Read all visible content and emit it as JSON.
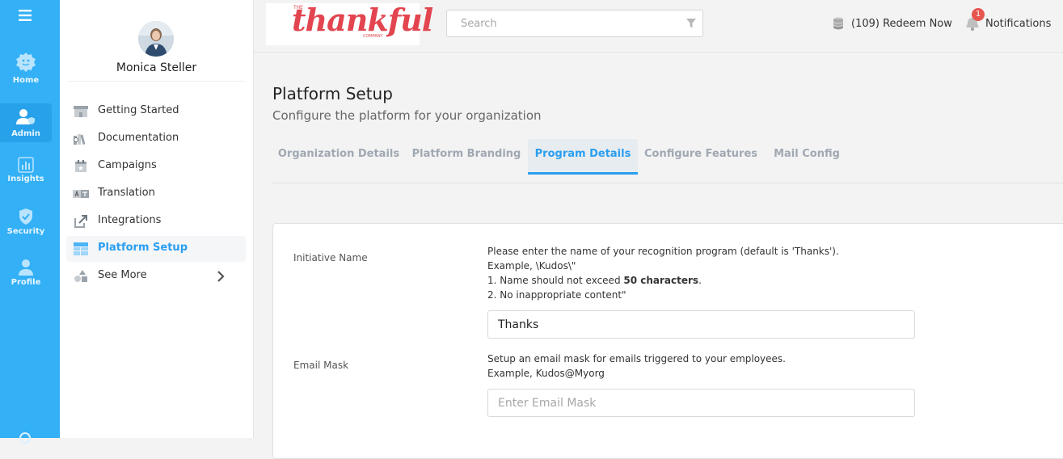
{
  "rail": {
    "items": [
      {
        "label": "Home",
        "icon": "home-icon"
      },
      {
        "label": "Admin",
        "icon": "admin-icon"
      },
      {
        "label": "Insights",
        "icon": "insights-icon"
      },
      {
        "label": "Security",
        "icon": "shield-icon"
      },
      {
        "label": "Profile",
        "icon": "profile-icon"
      }
    ]
  },
  "user": {
    "name": "Monica Steller"
  },
  "nav": {
    "items": [
      {
        "label": "Getting Started",
        "icon": "store-icon"
      },
      {
        "label": "Documentation",
        "icon": "books-icon"
      },
      {
        "label": "Campaigns",
        "icon": "calendar-icon"
      },
      {
        "label": "Translation",
        "icon": "translate-icon"
      },
      {
        "label": "Integrations",
        "icon": "external-link-icon"
      },
      {
        "label": "Platform Setup",
        "icon": "layout-icon"
      },
      {
        "label": "See More",
        "icon": "shapes-icon"
      }
    ]
  },
  "topbar": {
    "logo_small": "THE",
    "logo_main": "thankful",
    "logo_sub": "COMPANY",
    "search_placeholder": "Search",
    "redeem": "(109) Redeem Now",
    "notif_count": "1",
    "notifications": "Notifications"
  },
  "page": {
    "title": "Platform Setup",
    "subtitle": "Configure the platform for your organization"
  },
  "tabs": [
    {
      "label": "Organization Details"
    },
    {
      "label": "Platform Branding"
    },
    {
      "label": "Program Details"
    },
    {
      "label": "Configure Features"
    },
    {
      "label": "Mail Config"
    }
  ],
  "form": {
    "initiative": {
      "label": "Initiative Name",
      "desc1": "Please enter the name of your recognition program (default is 'Thanks').",
      "desc2": "Example, \\Kudos\\\"",
      "desc3_pre": "1. Name should not exceed ",
      "desc3_bold": "50 characters",
      "desc3_post": ".",
      "desc4": "2. No inappropriate content\"",
      "value": "Thanks"
    },
    "email_mask": {
      "label": "Email Mask",
      "desc1": "Setup an email mask for emails triggered to your employees.",
      "desc2": "Example, Kudos@Myorg",
      "placeholder": "Enter Email Mask"
    }
  },
  "colors": {
    "rail": "#33b0f6",
    "accent": "#2a9ef0",
    "badge": "#e8544e",
    "logo": "#e2454f"
  }
}
